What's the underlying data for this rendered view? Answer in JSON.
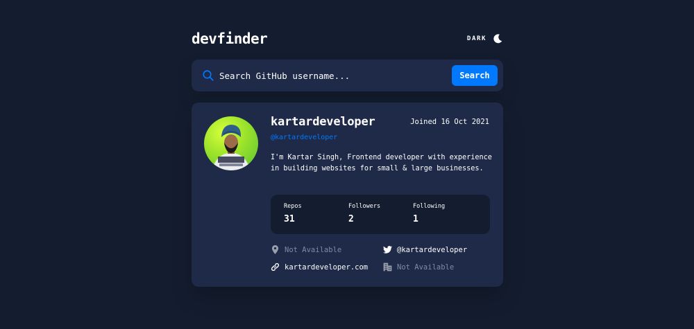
{
  "header": {
    "logo": "devfinder",
    "theme_label": "DARK"
  },
  "search": {
    "placeholder": "Search GitHub username...",
    "value": "",
    "button_label": "Search"
  },
  "profile": {
    "name": "kartardeveloper",
    "login": "@kartardeveloper",
    "joined": "Joined 16 Oct 2021",
    "bio": "I'm Kartar Singh, Frontend developer with experience in building websites for small & large businesses.",
    "stats": {
      "repos_label": "Repos",
      "repos": "31",
      "followers_label": "Followers",
      "followers": "2",
      "following_label": "Following",
      "following": "1"
    },
    "links": {
      "location": "Not Available",
      "twitter": "@kartardeveloper",
      "website": "kartardeveloper.com",
      "company": "Not Available"
    }
  },
  "icons": {
    "theme": "moon-icon",
    "search": "search-icon",
    "location": "location-pin-icon",
    "twitter": "twitter-icon",
    "website": "link-icon",
    "company": "building-icon"
  },
  "colors": {
    "background": "#141d2f",
    "card": "#1e2a47",
    "accent": "#0079ff",
    "unavailable": "#7f8aa3"
  }
}
